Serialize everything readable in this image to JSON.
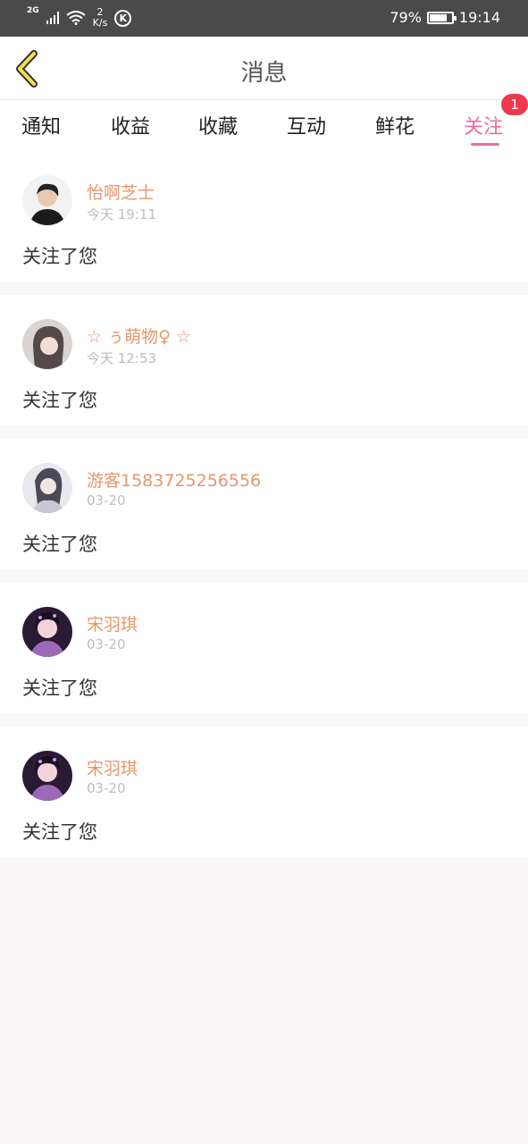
{
  "status": {
    "network": "2G",
    "speed_value": "2",
    "speed_unit": "K/s",
    "k_label": "K",
    "battery": "79%",
    "battery_level": 0.79,
    "time": "19:14"
  },
  "header": {
    "title": "消息",
    "back_icon": "chevron-left-icon",
    "accent": "#f4e04d"
  },
  "tabs": [
    {
      "label": "通知",
      "active": false
    },
    {
      "label": "收益",
      "active": false
    },
    {
      "label": "收藏",
      "active": false
    },
    {
      "label": "互动",
      "active": false
    },
    {
      "label": "鲜花",
      "active": false
    },
    {
      "label": "关注",
      "active": true,
      "badge": "1"
    }
  ],
  "messages": [
    {
      "sender": "怡啊芝士",
      "time": "今天 19:11",
      "content": "关注了您"
    },
    {
      "sender": "☆ ぅ萌物♀ ☆",
      "time": "今天 12:53",
      "content": "关注了您"
    },
    {
      "sender": "游客1583725256556",
      "time": "03-20",
      "content": "关注了您"
    },
    {
      "sender": "宋羽琪",
      "time": "03-20",
      "content": "关注了您"
    },
    {
      "sender": "宋羽琪",
      "time": "03-20",
      "content": "关注了您"
    }
  ],
  "colors": {
    "accent": "#e86fa3",
    "sender": "#e5976c",
    "badge": "#f0384d"
  }
}
